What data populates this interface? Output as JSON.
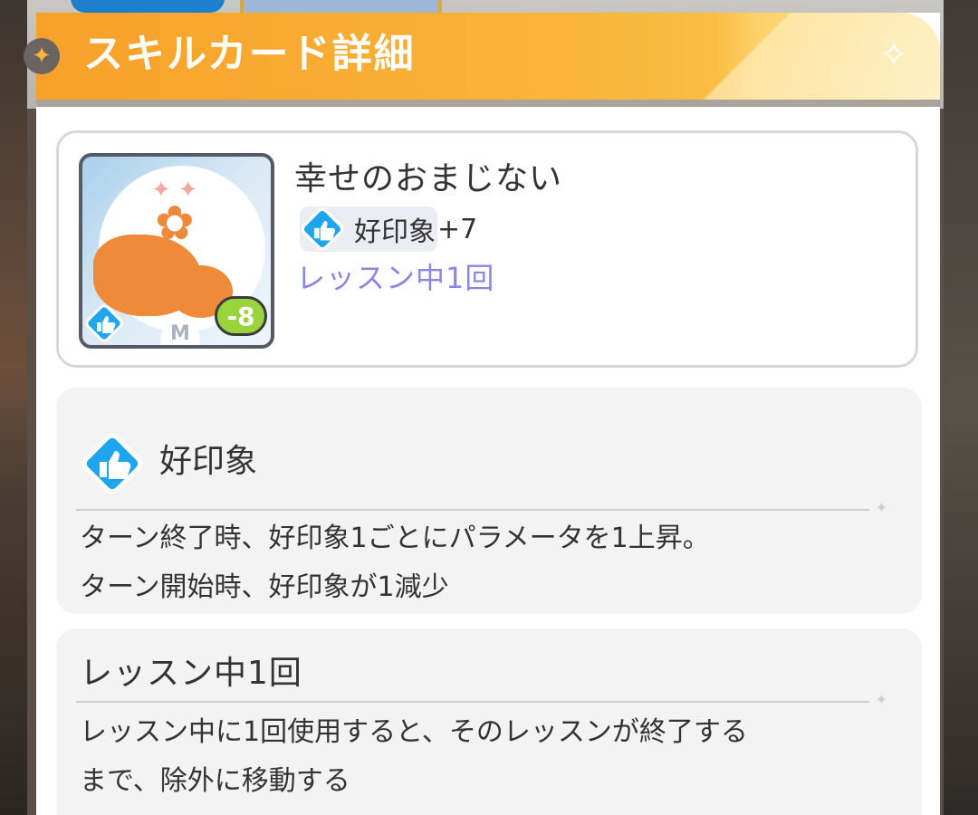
{
  "header": {
    "title": "スキルカード詳細"
  },
  "card": {
    "name": "幸せのおまじない",
    "effect_label": "好印象",
    "effect_value": "+7",
    "limit": "レッスン中1回",
    "cost": "-8",
    "art_badge": "M"
  },
  "sections": [
    {
      "title": "好印象",
      "icon": "thumbs-up-icon",
      "description": "ターン終了時、好印象1ごとにパラメータを1上昇。\nターン開始時、好印象が1減少"
    },
    {
      "title": "レッスン中1回",
      "description": "レッスン中に1回使用すると、そのレッスンが終了する\nまで、除外に移動する"
    }
  ],
  "colors": {
    "header_orange": "#f7a12a",
    "limit_purple": "#8a86e6",
    "icon_blue": "#1fa5ee",
    "cost_green": "#9ad43c",
    "art_orange": "#ef8a3a"
  }
}
